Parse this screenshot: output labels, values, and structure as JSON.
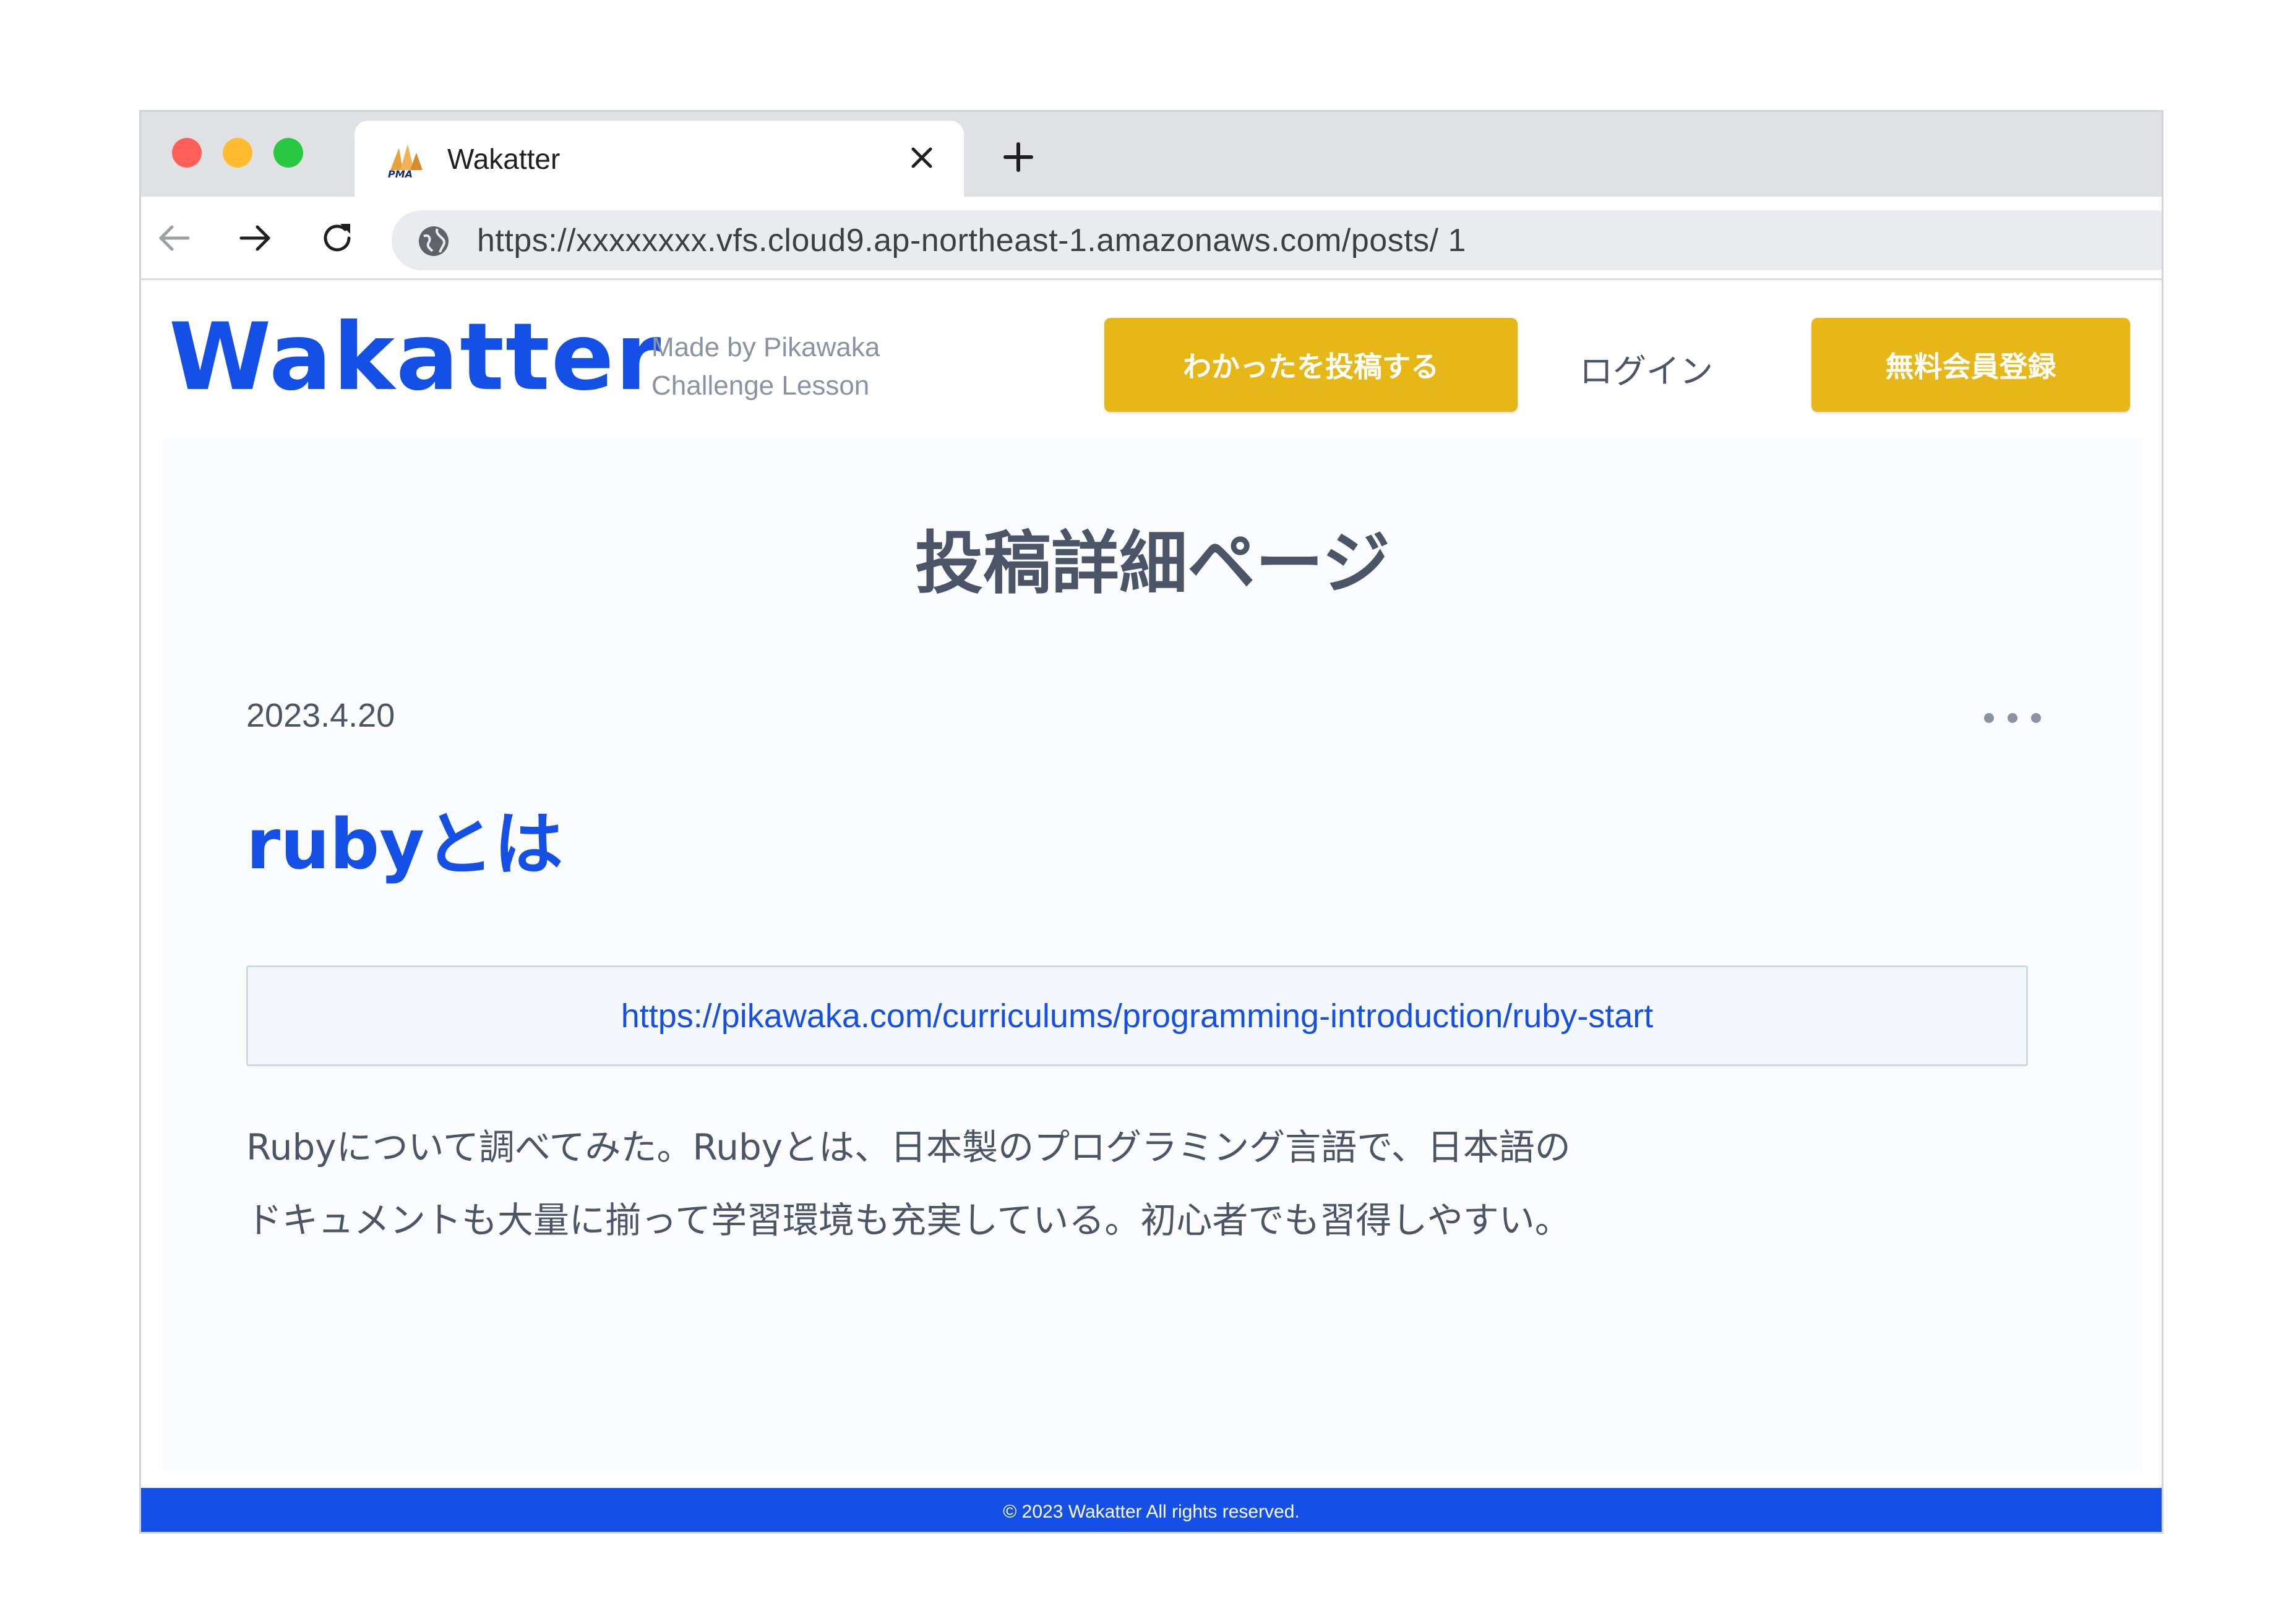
{
  "browser": {
    "tab_title": "Wakatter",
    "favicon_text": "PMA",
    "url": "https://xxxxxxxx.vfs.cloud9.ap-northeast-1.amazonaws.com/posts/ 1"
  },
  "header": {
    "logo": "Wakatter",
    "tagline_line1": "Made by Pikawaka",
    "tagline_line2": "Challenge Lesson",
    "post_button": "わかったを投稿する",
    "login_link": "ログイン",
    "register_button": "無料会員登録"
  },
  "main": {
    "page_title": "投稿詳細ページ",
    "post": {
      "date": "2023.4.20",
      "title": "rubyとは",
      "link": "https://pikawaka.com/curriculums/programming-introduction/ruby-start",
      "body_line1": "Rubyについて調べてみた。Rubyとは、日本製のプログラミング言語で、日本語の",
      "body_line2": "ドキュメントも大量に揃って学習環境も充実している。初心者でも習得しやすい。"
    }
  },
  "footer": {
    "copyright": "© 2023 Wakatter All rights reserved."
  },
  "colors": {
    "brand_blue": "#1550e6",
    "accent_yellow": "#e6b716",
    "text_gray": "#4a5568"
  }
}
